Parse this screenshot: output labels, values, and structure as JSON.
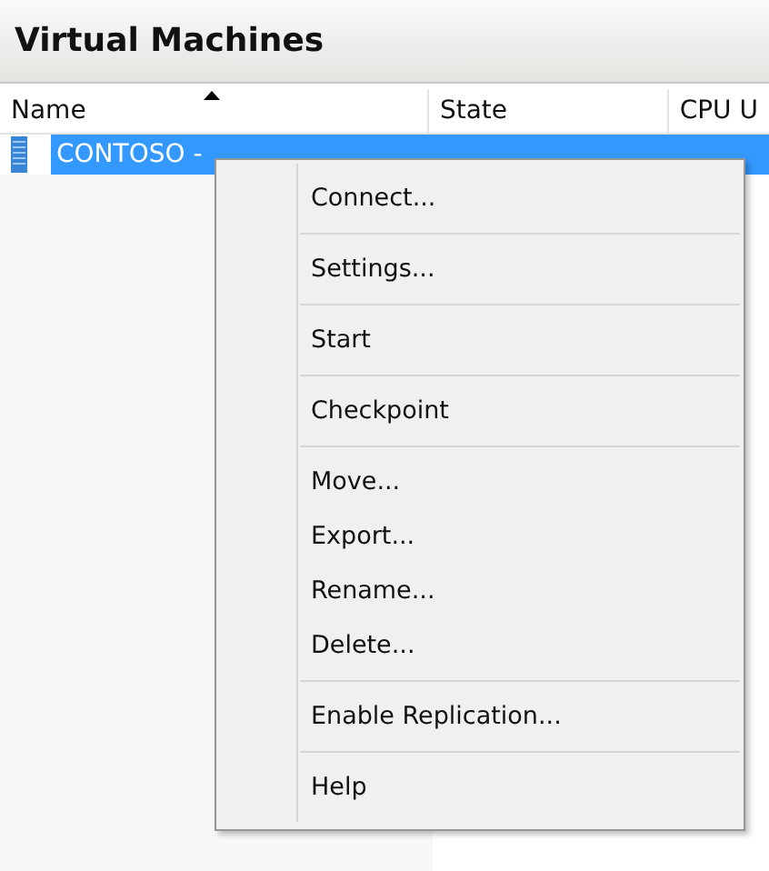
{
  "panel": {
    "title": "Virtual Machines"
  },
  "table": {
    "columns": [
      {
        "label": "Name",
        "sorted": true
      },
      {
        "label": "State",
        "sorted": false
      },
      {
        "label": "CPU U",
        "sorted": false
      }
    ],
    "rows": [
      {
        "name": "CONTOSO -",
        "selected": true
      }
    ]
  },
  "context_menu": {
    "groups": [
      {
        "items": [
          "Connect..."
        ]
      },
      {
        "items": [
          "Settings..."
        ]
      },
      {
        "items": [
          "Start"
        ]
      },
      {
        "items": [
          "Checkpoint"
        ]
      },
      {
        "items": [
          "Move...",
          "Export...",
          "Rename...",
          "Delete..."
        ]
      },
      {
        "items": [
          "Enable Replication..."
        ]
      },
      {
        "items": [
          "Help"
        ]
      }
    ]
  }
}
